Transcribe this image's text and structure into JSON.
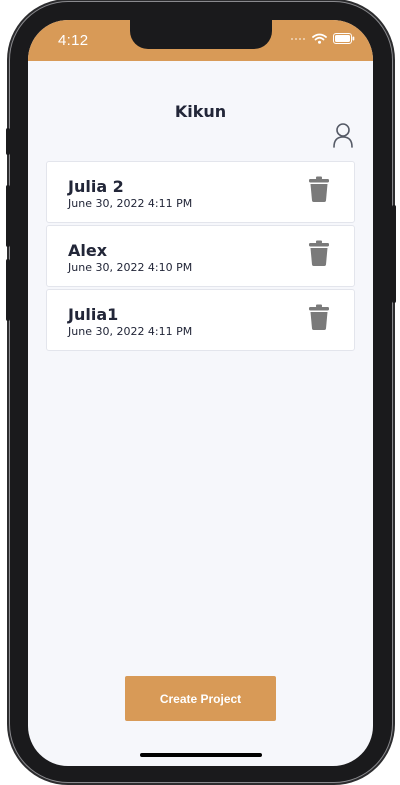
{
  "status_bar": {
    "time": "4:12",
    "icons": [
      "signal-dots-icon",
      "wifi-icon",
      "battery-icon"
    ]
  },
  "header": {
    "title": "Kikun",
    "profile_icon": "person-icon"
  },
  "projects": [
    {
      "name": "Julia 2",
      "date": "June 30, 2022 4:11 PM",
      "delete_icon": "trash-icon"
    },
    {
      "name": "Alex",
      "date": "June 30, 2022 4:10 PM",
      "delete_icon": "trash-icon"
    },
    {
      "name": "Julia1",
      "date": "June 30, 2022 4:11 PM",
      "delete_icon": "trash-icon"
    }
  ],
  "footer": {
    "create_label": "Create Project"
  },
  "colors": {
    "accent": "#d89a57",
    "background": "#f6f7fb",
    "text": "#222638",
    "icon": "#7a7a7a"
  }
}
